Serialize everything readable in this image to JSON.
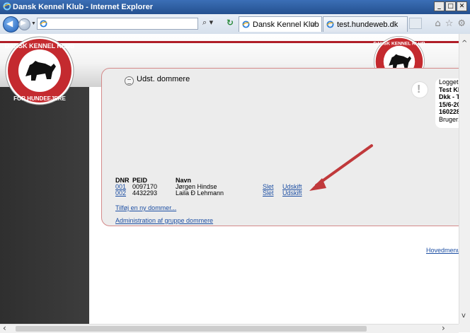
{
  "window": {
    "title": "Dansk Kennel Klub - Internet Explorer",
    "buttons": {
      "minimize": "_",
      "maximize": "□",
      "close": "✕"
    }
  },
  "browser": {
    "address_value": "",
    "search_glyph": "⌕ ▾",
    "refresh_glyph": "↻",
    "tabs": [
      {
        "label": "Dansk Kennel Klub",
        "close": "✕",
        "active": true
      },
      {
        "label": "test.hundeweb.dk",
        "active": false
      }
    ],
    "toolbar_icons": {
      "home": "⌂",
      "favorites": "☆",
      "tools": "⚙"
    }
  },
  "page": {
    "logo_text_top": "DANSK KENNEL KLUB",
    "logo_text_bottom": "FOR HUNDEEJERE",
    "section_title": "Udst. dommere",
    "info": {
      "line1": "Logget",
      "line2": "Test Kl",
      "line3": "Dkk - T",
      "line4": "15/6-20",
      "line5": "160228",
      "line6": "Bruger:"
    },
    "table": {
      "headers": {
        "dnr": "DNR",
        "peid": "PEID",
        "navn": "Navn"
      },
      "rows": [
        {
          "dnr": "001",
          "peid": "0097170",
          "navn": "Jørgen Hindse",
          "delete": "Slet",
          "replace": "Udskift"
        },
        {
          "dnr": "002",
          "peid": "4432293",
          "navn": "Laila Ð Lehmann",
          "delete": "Slet",
          "replace": "Udskift"
        }
      ]
    },
    "add_link": "Tilføj en ny dommer...",
    "admin_link": "Administration af gruppe dommere",
    "main_menu_link": "Hovedmenu"
  },
  "colors": {
    "brand_red": "#b01e28",
    "link_blue": "#1d4fa3",
    "arrow_red": "#c0393b"
  }
}
